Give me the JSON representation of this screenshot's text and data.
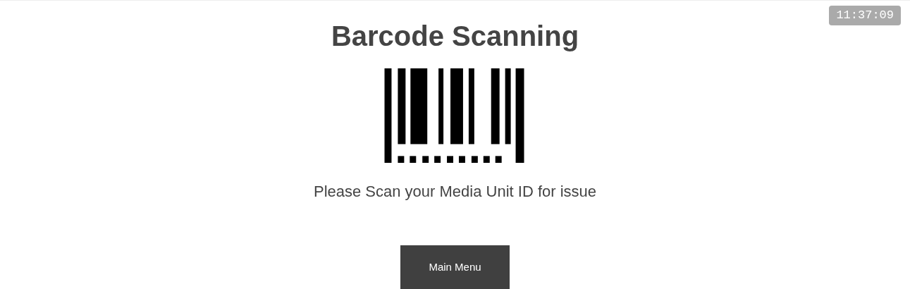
{
  "clock": "11:37:09",
  "title": "Barcode Scanning",
  "instruction": "Please Scan your Media Unit ID for issue",
  "button": "Main Menu"
}
